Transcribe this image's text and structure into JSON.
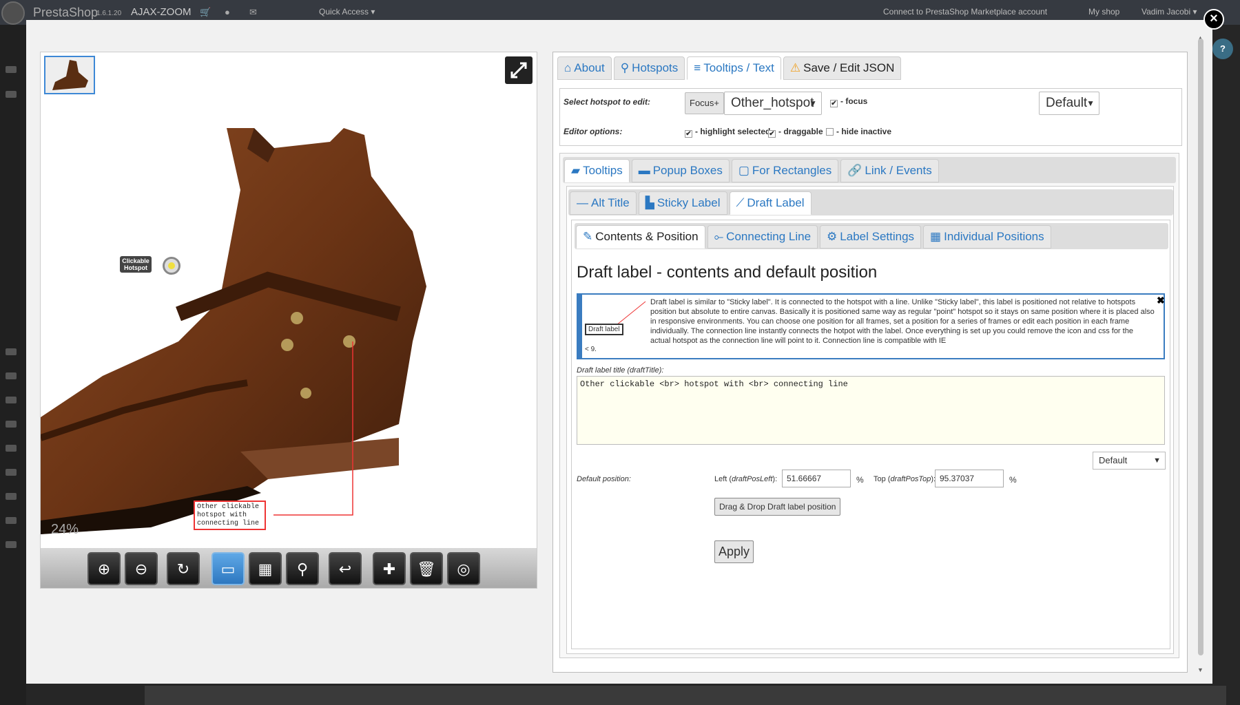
{
  "topbar": {
    "brand": "PrestaShop",
    "version": "1.6.1.20",
    "module": "AJAX-ZOOM",
    "quick_access": "Quick Access ▾",
    "connect": "Connect to PrestaShop Marketplace account",
    "my_shop": "My shop",
    "user": "Vadim Jacobi ▾",
    "help": "?"
  },
  "modal": {
    "close": "×"
  },
  "viewer": {
    "zoom_percent": "24%",
    "hotspot_label": "Clickable Hotspot",
    "draft_label": "Other clickable\nhotspot with\nconnecting line",
    "toolbar_buttons": [
      "zoom-in",
      "zoom-out",
      "rotate",
      "fullscreen-view",
      "gallery",
      "hotspot-pin",
      "undo",
      "hotspot-add",
      "delete",
      "spin"
    ]
  },
  "editor": {
    "main_tabs": [
      {
        "icon": "home-icon",
        "glyph": "⌂",
        "label": "About"
      },
      {
        "icon": "map-pin-icon",
        "glyph": "⚲",
        "label": "Hotspots"
      },
      {
        "icon": "list-icon",
        "glyph": "≡",
        "label": "Tooltips / Text"
      },
      {
        "icon": "warning-icon",
        "glyph": "⚠",
        "label": "Save / Edit JSON"
      }
    ],
    "select_hotspot_label": "Select hotspot to edit:",
    "focus_btn": "Focus+",
    "hotspot_select": "Other_hotspot",
    "focus_label": "- focus",
    "default_select": "Default",
    "editor_options_label": "Editor options:",
    "opt_highlight": "- highlight selected",
    "opt_draggable": "- draggable",
    "opt_hide_inactive": "- hide inactive",
    "sub_tabs": [
      "Tooltips",
      "Popup Boxes",
      "For Rectangles",
      "Link / Events"
    ],
    "label_tabs": [
      "Alt Title",
      "Sticky Label",
      "Draft Label"
    ],
    "draft_tabs": [
      "Contents & Position",
      "Connecting Line",
      "Label Settings",
      "Individual Positions"
    ],
    "heading": "Draft label - contents and default position",
    "info_mini_label": "Draft label",
    "info_mini_sub": "< 9.",
    "info_text": "Draft label is similar to \"Sticky label\". It is connected to the hotspot with a line. Unlike \"Sticky label\", this label is positioned not relative to hotspots position but absolute to entire canvas. Basically it is positioned same way as regular \"point\" hotspot so it stays on same position where it is placed also in responsive environments. You can choose one position for all frames, set a position for a series of frames or edit each position in each frame individually. The connection line instantly connects the hotpot with the label. Once everything is set up you could remove the icon and css for the actual hotspot as the connection line will point to it. Connection line is compatible with IE",
    "info_close": "✖",
    "title_label": "Draft label title (draftTitle):",
    "title_value": "Other clickable <br> hotspot with <br> connecting line",
    "position_select": "Default",
    "default_position_label": "Default position:",
    "left_label": "Left (",
    "left_key": "draftPosLeft",
    "left_value": "51.66667",
    "top_label": "Top (",
    "top_key": "draftPosTop",
    "top_value": "95.37037",
    "pct": "%",
    "drag_btn": "Drag & Drop Draft label position",
    "apply_btn": "Apply"
  }
}
